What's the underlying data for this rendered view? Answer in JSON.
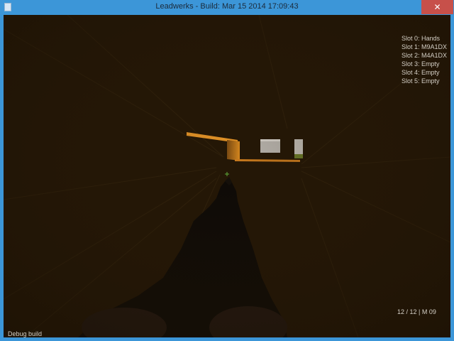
{
  "window": {
    "title": "Leadwerks - Build: Mar 15 2014 17:09:43",
    "close_glyph": "✕"
  },
  "hud": {
    "slots": [
      "Slot 0: Hands",
      "Slot 1: M9A1DX",
      "Slot 2: M4A1DX",
      "Slot 3: Empty",
      "Slot 4: Empty",
      "Slot 5: Empty"
    ],
    "ammo": "12 / 12 | M 09",
    "build_label": "Debug build"
  },
  "colors": {
    "titlebar": "#3c96d8",
    "close_button": "#c7504a",
    "viewport_bg": "#241706",
    "hud_text": "#d4cfc6",
    "platform_orange": "#c87a1e",
    "crosshair": "#5fae3a"
  },
  "icons": {
    "app": "app-window-icon",
    "close": "close-icon",
    "crosshair": "crosshair-icon"
  }
}
